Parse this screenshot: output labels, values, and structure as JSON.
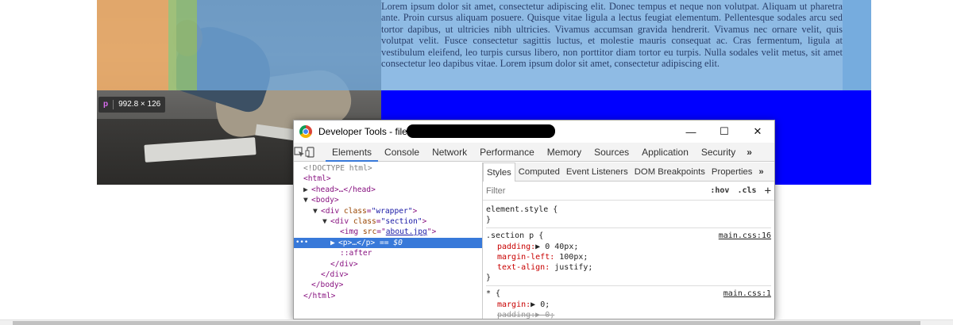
{
  "page": {
    "paragraph": "Lorem ipsum dolor sit amet, consectetur adipiscing elit. Donec tempus et neque non volutpat. Aliquam ut pharetra ante. Proin cursus aliquam posuere. Quisque vitae ligula a lectus feugiat elementum. Pellentesque sodales arcu sed tortor dapibus, ut ultricies nibh ultricies. Vivamus accumsan gravida hendrerit. Vivamus nec ornare velit, quis volutpat velit. Fusce consectetur sagittis luctus, et molestie mauris consequat ac. Cras fermentum, ligula at vestibulum eleifend, leo turpis cursus libero, non porttitor diam tortor eu turpis. Nulla sodales velit metus, sit amet consectetur leo dapibus vitae. Lorem ipsum dolor sit amet, consectetur adipiscing elit.",
    "size_tooltip": {
      "tag": "p",
      "dims": "992.8 × 126"
    },
    "colors": {
      "highlight_blue": "#6fa8dc",
      "margin_orange": "#f6b26b",
      "padding_green": "#93c47d",
      "background_blue": "#0000ff"
    }
  },
  "devtools": {
    "title": "Developer Tools - file:///D:/Users/",
    "window_controls": {
      "minimize": "—",
      "maximize": "☐",
      "close": "✕"
    },
    "tabs": [
      "Elements",
      "Console",
      "Network",
      "Performance",
      "Memory",
      "Sources",
      "Application",
      "Security"
    ],
    "active_tab": "Elements",
    "more_tabs": "»",
    "menu": "⋮",
    "dom": {
      "doctype": "<!DOCTYPE html>",
      "html_open": "<html>",
      "head": "<head>…</head>",
      "body_open": "<body>",
      "wrapper_open_tag": "div",
      "wrapper_attr": "class",
      "wrapper_val": "\"wrapper\"",
      "section_open_tag": "div",
      "section_attr": "class",
      "section_val": "\"section\"",
      "img_attr": "src",
      "img_src": "about.jpg",
      "selected": "<p>…</p>",
      "selected_suffix": " == $0",
      "after": "::after",
      "div_close": "</div>",
      "div_close2": "</div>",
      "body_close": "</body>",
      "html_close": "</html>"
    },
    "styles": {
      "subtabs": [
        "Styles",
        "Computed",
        "Event Listeners",
        "DOM Breakpoints",
        "Properties"
      ],
      "more": "»",
      "filter_placeholder": "Filter",
      "hov": ":hov",
      "cls": ".cls",
      "add": "+",
      "element_style": "element.style {",
      "close_brace": "}",
      "rule1": {
        "selector": ".section p {",
        "source": "main.css:16",
        "decls": [
          {
            "prop": "padding:",
            "val": "▶ 0 40px;"
          },
          {
            "prop": "margin-left:",
            "val": " 100px;"
          },
          {
            "prop": "text-align:",
            "val": " justify;"
          }
        ]
      },
      "rule2": {
        "selector": "* {",
        "source": "main.css:1",
        "decls": [
          {
            "prop": "margin:",
            "val": "▶ 0;"
          },
          {
            "prop": "padding:",
            "val": "▶ 0;"
          }
        ]
      }
    }
  }
}
